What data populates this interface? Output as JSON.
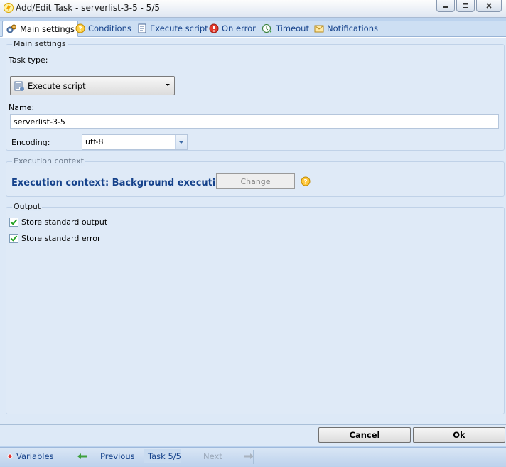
{
  "window": {
    "title": "Add/Edit Task - serverlist-3-5 - 5/5",
    "icon": "lightning-icon",
    "controls": [
      "minimize-icon",
      "maximize-icon",
      "close-icon"
    ]
  },
  "tabs": [
    {
      "label": "Main settings",
      "icon": "gears-icon",
      "active": true
    },
    {
      "label": "Conditions",
      "icon": "conditions-icon",
      "active": false
    },
    {
      "label": "Execute script",
      "icon": "script-icon",
      "active": false
    },
    {
      "label": "On error",
      "icon": "error-icon",
      "active": false
    },
    {
      "label": "Timeout",
      "icon": "timeout-icon",
      "active": false
    },
    {
      "label": "Notifications",
      "icon": "envelope-icon",
      "active": false
    }
  ],
  "main_settings": {
    "group_title": "Main settings",
    "task_type_label": "Task type:",
    "task_type_value": "Execute script",
    "name_label": "Name:",
    "name_value": "serverlist-3-5",
    "encoding_label": "Encoding:",
    "encoding_value": "utf-8"
  },
  "execution_context": {
    "group_title": "Execution context",
    "text": "Execution context: Background execution",
    "change_label": "Change",
    "change_enabled": false
  },
  "output": {
    "group_title": "Output",
    "store_stdout_label": "Store standard output",
    "store_stdout_checked": true,
    "store_stderr_label": "Store standard error",
    "store_stderr_checked": true
  },
  "footer": {
    "cancel_label": "Cancel",
    "ok_label": "Ok"
  },
  "statusbar": {
    "variables_label": "Variables",
    "previous_label": "Previous",
    "task_label": "Task 5/5",
    "next_label": "Next",
    "next_enabled": false
  },
  "colors": {
    "accent": "#15428b",
    "panel": "#dde9f7",
    "tab_strip": "#cddff3"
  }
}
